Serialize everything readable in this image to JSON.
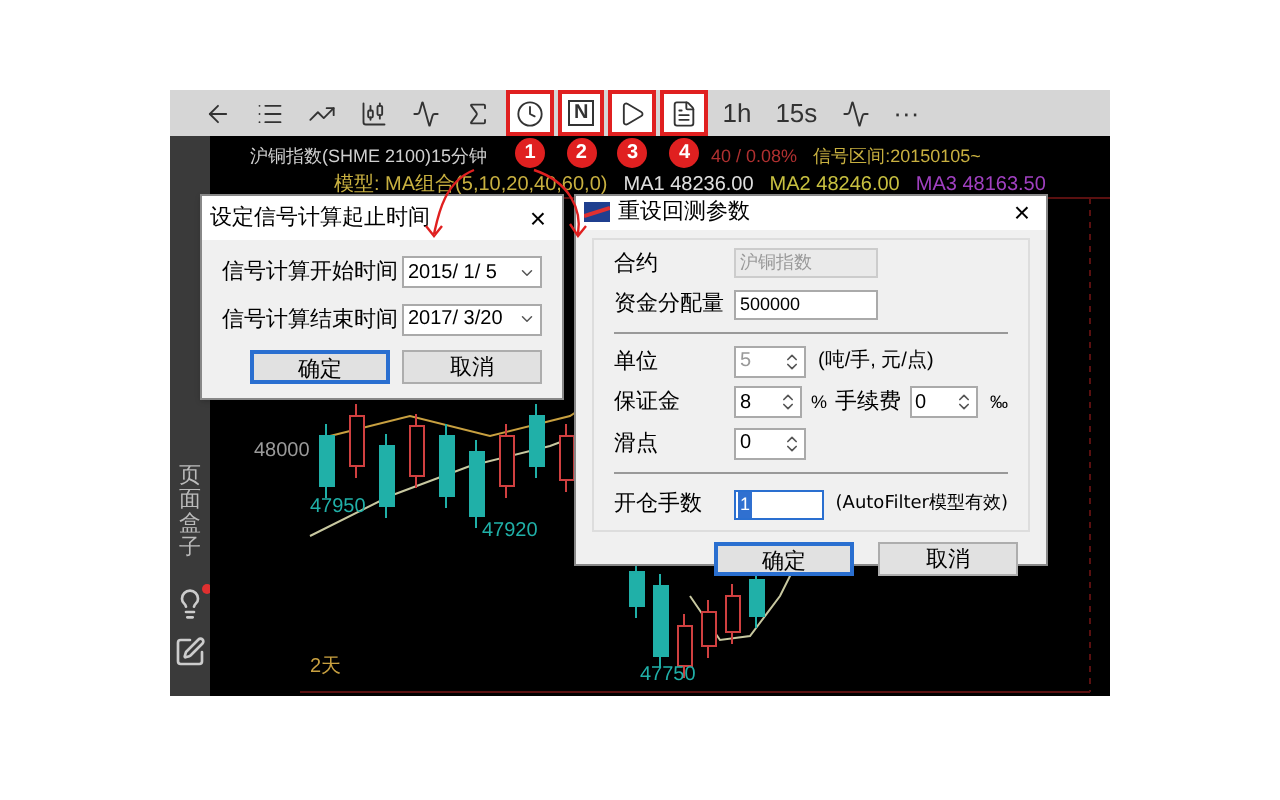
{
  "toolbar": {
    "items": [
      {
        "kind": "icon",
        "highlighted": false
      },
      {
        "kind": "icon",
        "highlighted": false
      },
      {
        "kind": "icon",
        "highlighted": false
      },
      {
        "kind": "icon",
        "highlighted": false
      },
      {
        "kind": "icon",
        "highlighted": false
      },
      {
        "kind": "icon",
        "highlighted": false
      },
      {
        "kind": "icon",
        "highlighted": true,
        "badge": "1"
      },
      {
        "kind": "boxed",
        "label": "N",
        "highlighted": true,
        "badge": "2"
      },
      {
        "kind": "icon",
        "highlighted": true,
        "badge": "3"
      },
      {
        "kind": "icon",
        "highlighted": true,
        "badge": "4"
      },
      {
        "kind": "text",
        "label": "1h",
        "highlighted": false
      },
      {
        "kind": "text",
        "label": "15s",
        "highlighted": false
      },
      {
        "kind": "icon",
        "highlighted": false
      },
      {
        "kind": "text",
        "label": "···",
        "highlighted": false
      }
    ]
  },
  "sidebar": {
    "label": "页面盒子",
    "items": [
      {
        "alert": true
      },
      {
        "alert": false
      }
    ]
  },
  "chart": {
    "header": [
      {
        "text": "沪铜指数(SHME 2100)15分钟",
        "color": "#d0d0d0"
      },
      {
        "text": "40 / 0.08%",
        "color": "#b03030"
      },
      {
        "text": "信号区间:20150105~",
        "color": "#c8b040"
      }
    ],
    "model_line": [
      {
        "text": "模型: MA组合(5,10,20,40,60,0)",
        "color": "#c8b040"
      },
      {
        "text": "MA1 48236.00",
        "color": "#e0e0e0"
      },
      {
        "text": "MA2 48246.00",
        "color": "#c8c040"
      },
      {
        "text": "MA3 48163.50",
        "color": "#a040c0"
      }
    ],
    "price_labels": [
      {
        "text": "48000",
        "color": "#9a9a9a"
      },
      {
        "text": "47950",
        "color": "#20b0a8"
      },
      {
        "text": "47920",
        "color": "#20b0a8"
      },
      {
        "text": "47750",
        "color": "#20b0a8"
      },
      {
        "text": "2天",
        "color": "#c8a040"
      }
    ]
  },
  "dialog_time": {
    "title": "设定信号计算起止时间",
    "close": "×",
    "rows": [
      {
        "label": "信号计算开始时间",
        "value": "2015/ 1/ 5"
      },
      {
        "label": "信号计算结束时间",
        "value": "2017/ 3/20"
      }
    ],
    "buttons": [
      {
        "label": "确定",
        "focused": true
      },
      {
        "label": "取消",
        "focused": false
      }
    ]
  },
  "dialog_params": {
    "title": "重设回测参数",
    "close": "×",
    "contract": {
      "label": "合约",
      "value": "沪铜指数",
      "disabled": true
    },
    "capital": {
      "label": "资金分配量",
      "value": "500000"
    },
    "unit": {
      "label": "单位",
      "value": "5",
      "disabled": true,
      "note": "(吨/手, 元/点)"
    },
    "margin": {
      "label": "保证金",
      "value": "8",
      "suffix": "%"
    },
    "fee": {
      "label": "手续费",
      "value": "0",
      "suffix": "‰"
    },
    "slippage": {
      "label": "滑点",
      "value": "0"
    },
    "lots": {
      "label": "开仓手数",
      "value": "1",
      "note": "(AutoFilter模型有效)"
    },
    "buttons": [
      {
        "label": "确定",
        "focused": true
      },
      {
        "label": "取消",
        "focused": false
      }
    ]
  }
}
